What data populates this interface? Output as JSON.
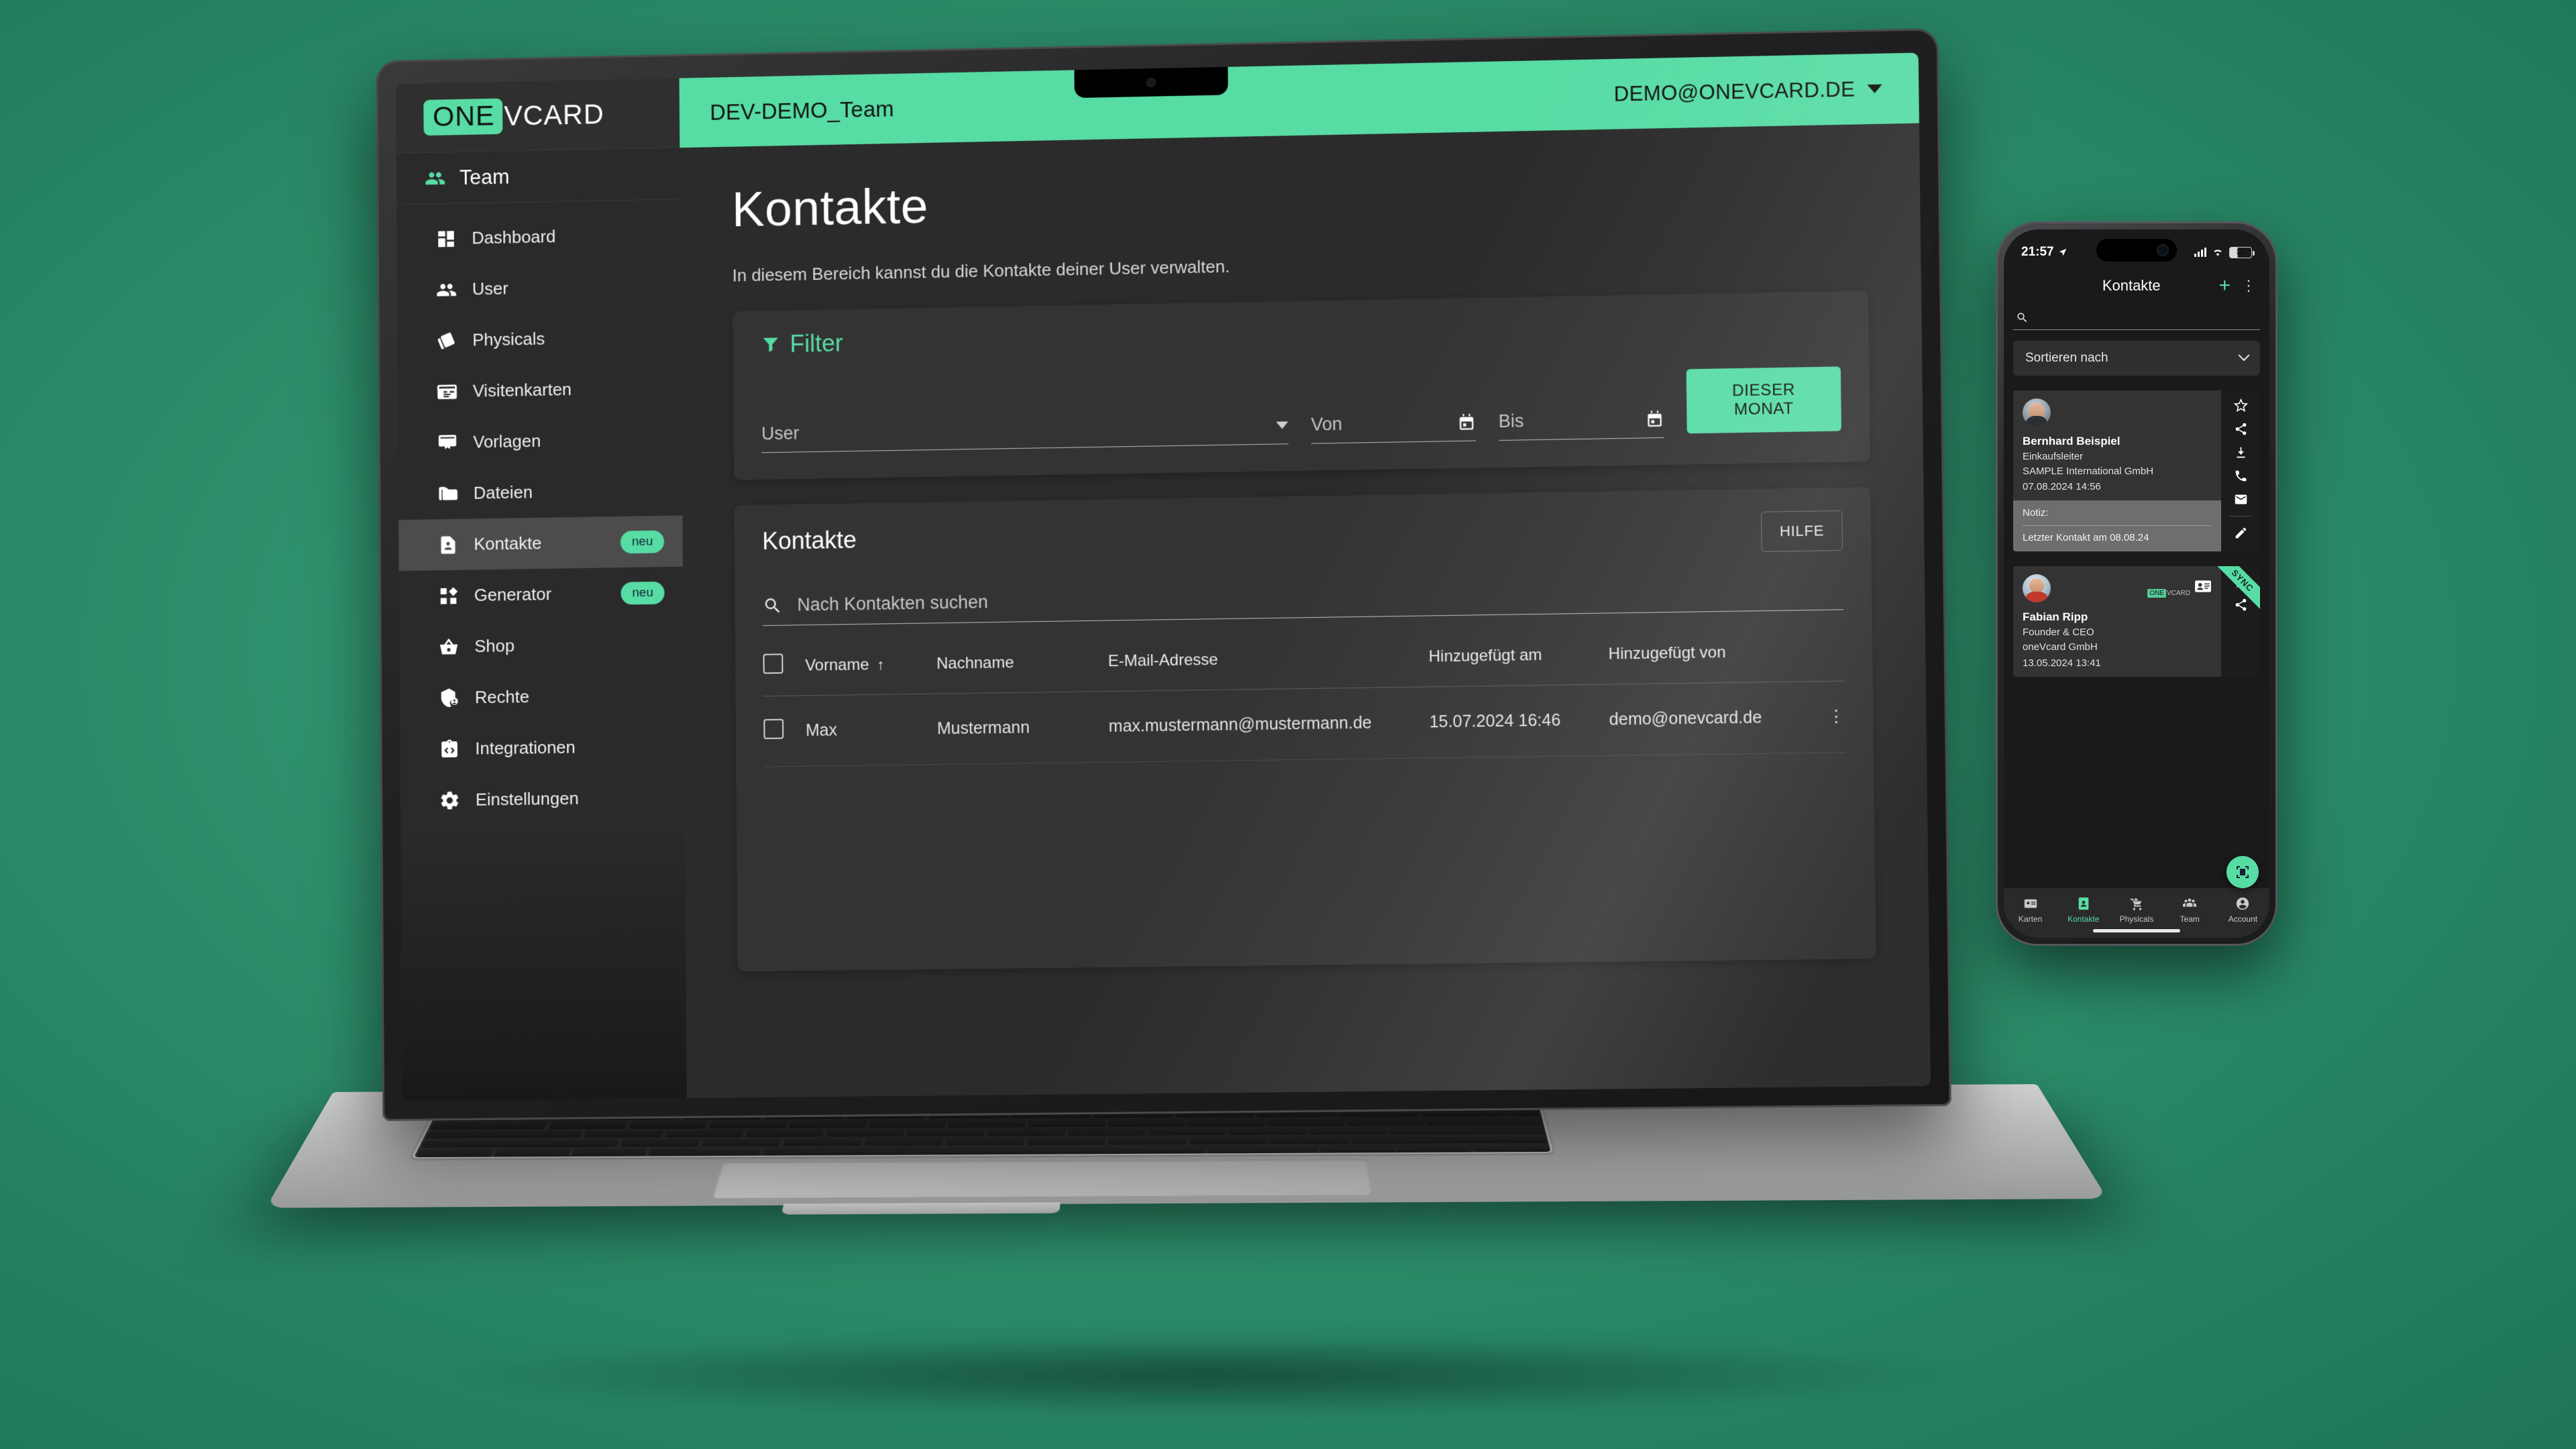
{
  "brand": {
    "logo_part1": "ONE",
    "logo_part2": "VCARD"
  },
  "desktop": {
    "topbar": {
      "team_name": "DEV-DEMO_Team",
      "account": "DEMO@ONEVCARD.DE"
    },
    "sidebar": {
      "team_label": "Team",
      "items": [
        {
          "label": "Dashboard",
          "icon": "dashboard-icon",
          "badge": ""
        },
        {
          "label": "User",
          "icon": "users-icon",
          "badge": ""
        },
        {
          "label": "Physicals",
          "icon": "cards-icon",
          "badge": ""
        },
        {
          "label": "Visitenkarten",
          "icon": "business-card-icon",
          "badge": ""
        },
        {
          "label": "Vorlagen",
          "icon": "template-icon",
          "badge": ""
        },
        {
          "label": "Dateien",
          "icon": "folder-icon",
          "badge": ""
        },
        {
          "label": "Kontakte",
          "icon": "contact-file-icon",
          "badge": "neu"
        },
        {
          "label": "Generator",
          "icon": "generator-icon",
          "badge": "neu"
        },
        {
          "label": "Shop",
          "icon": "basket-icon",
          "badge": ""
        },
        {
          "label": "Rechte",
          "icon": "shield-user-icon",
          "badge": ""
        },
        {
          "label": "Integrationen",
          "icon": "code-clipboard-icon",
          "badge": ""
        },
        {
          "label": "Einstellungen",
          "icon": "gear-icon",
          "badge": ""
        }
      ]
    },
    "page": {
      "title": "Kontakte",
      "subtitle": "In diesem Bereich kannst du die Kontakte deiner User verwalten."
    },
    "filter": {
      "title": "Filter",
      "user_placeholder": "User",
      "von_placeholder": "Von",
      "bis_placeholder": "Bis",
      "month_button": "DIESER MONAT"
    },
    "table_section": {
      "title": "Kontakte",
      "help_button": "HILFE",
      "search_placeholder": "Nach Kontakten suchen",
      "columns": [
        "Vorname",
        "Nachname",
        "E-Mail-Adresse",
        "Hinzugefügt am",
        "Hinzugefügt von"
      ],
      "sort_column": "Vorname",
      "sort_arrow": "↑",
      "rows": [
        {
          "vorname": "Max",
          "nachname": "Mustermann",
          "email": "max.mustermann@mustermann.de",
          "hinzugefuegt_am": "15.07.2024 16:46",
          "hinzugefuegt_von": "demo@onevcard.de"
        }
      ]
    }
  },
  "phone": {
    "status": {
      "time": "21:57",
      "battery": "36"
    },
    "header": {
      "title": "Kontakte"
    },
    "search_placeholder": "",
    "sort_label": "Sortieren nach",
    "contacts": [
      {
        "name": "Bernhard Beispiel",
        "role": "Einkaufsleiter",
        "company": "SAMPLE International GmbH",
        "date": "07.08.2024 14:56",
        "note_label": "Notiz:",
        "note_text": "Letzter Kontakt am 08.08.24",
        "sync": ""
      },
      {
        "name": "Fabian Ripp",
        "role": "Founder & CEO",
        "company": "oneVcard GmbH",
        "date": "13.05.2024 13:41",
        "note_label": "",
        "note_text": "",
        "sync": "SYNC"
      }
    ],
    "action_icons": [
      "star-icon",
      "share-icon",
      "download-icon",
      "phone-icon",
      "email-icon",
      "edit-icon"
    ],
    "fab": "scan-qr-icon",
    "tabs": [
      {
        "label": "Karten",
        "icon": "card-icon",
        "active": false
      },
      {
        "label": "Kontakte",
        "icon": "contact-icon",
        "active": true
      },
      {
        "label": "Physicals",
        "icon": "cart-add-icon",
        "active": false
      },
      {
        "label": "Team",
        "icon": "team-icon",
        "active": false
      },
      {
        "label": "Account",
        "icon": "account-icon",
        "active": false
      }
    ]
  },
  "colors": {
    "accent": "#57dca4",
    "sidebar_bg": "#2a2a2a",
    "card_bg": "#333333",
    "page_bg": "#2b2b2b"
  }
}
